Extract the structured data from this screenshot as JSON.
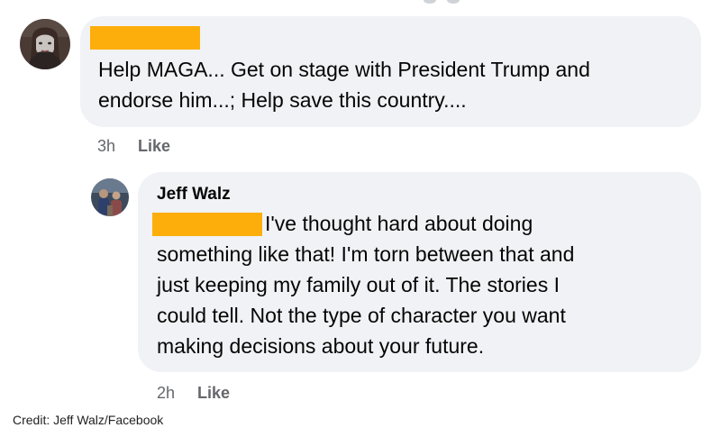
{
  "comments": [
    {
      "author": "",
      "author_redacted": true,
      "text_lines": [
        "Help MAGA... Get on stage with President Trump and",
        "endorse him...; Help save this country...."
      ],
      "time": "3h",
      "like_label": "Like"
    },
    {
      "author": "Jeff Walz",
      "mention_redacted": true,
      "text_lines": [
        "I've thought hard about doing",
        "something like that! I'm torn between that and",
        "just keeping my family out of it. The stories I",
        "could tell. Not the type of character you want",
        "making decisions about your future."
      ],
      "time": "2h",
      "like_label": "Like"
    }
  ],
  "credit": "Credit: Jeff Walz/Facebook",
  "colors": {
    "bubble_bg": "#f0f2f5",
    "redaction": "#fdae0a",
    "meta_text": "#65676b",
    "text": "#050505"
  }
}
